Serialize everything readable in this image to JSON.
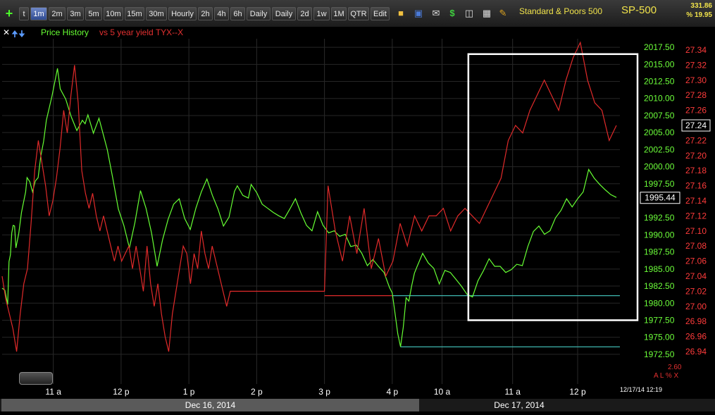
{
  "toolbar": {
    "buttons": [
      "t",
      "1m",
      "2m",
      "3m",
      "5m",
      "10m",
      "15m",
      "30m",
      "Hourly",
      "2h",
      "4h",
      "6h",
      "Daily",
      "Daily",
      "2d",
      "1w",
      "1M",
      "QTR",
      "Edit"
    ],
    "active": "1m",
    "symbol_name": "Standard & Poors 500",
    "ticker": "SP-500",
    "change_value": "331.86",
    "change_pct": "% 19.95"
  },
  "legend": {
    "label1": "Price History",
    "label2": "vs 5 year yield TYX--X"
  },
  "footer": {
    "dates": [
      "Dec 16, 2014",
      "Dec 17, 2014"
    ],
    "timestamp": "12/17/14 12:19",
    "small_label": "2.60",
    "indicator_letters": "A L % X"
  },
  "colors": {
    "price": "#66ff33",
    "yield": "#e02a2a",
    "left_axis": "#6cff3a",
    "right_axis": "#ff3b3b",
    "cyan": "#3fb8b0",
    "box": "#ffffff"
  },
  "chart_data": {
    "type": "line",
    "x_ticks": [
      "11 a",
      "12 p",
      "1 p",
      "2 p",
      "3 p",
      "4 p",
      "10 a",
      "11 a",
      "12 p"
    ],
    "left_axis": {
      "ticks": [
        2017.5,
        2015,
        2012.5,
        2010,
        2007.5,
        2005,
        2002.5,
        2000,
        1997.5,
        1995,
        1992.5,
        1990,
        1987.5,
        1985,
        1982.5,
        1980,
        1977.5,
        1975,
        1972.5
      ],
      "range": [
        1971.25,
        2018.75
      ],
      "current": 1995.44
    },
    "right_axis": {
      "ticks": [
        27.34,
        27.32,
        27.3,
        27.28,
        27.26,
        27.24,
        27.22,
        27.2,
        27.18,
        27.16,
        27.14,
        27.12,
        27.1,
        27.08,
        27.06,
        27.04,
        27.02,
        27.0,
        26.98,
        26.96,
        26.94
      ],
      "range": [
        26.925,
        27.355
      ],
      "current": 27.24
    },
    "horizontal_lines": [
      {
        "axis": "left",
        "value": 1981.1,
        "from": "3 p",
        "to": "end",
        "color": "red-cyan"
      },
      {
        "axis": "left",
        "value": 1973.6,
        "from": "4 p",
        "to": "end",
        "color": "cyan"
      }
    ],
    "series": [
      {
        "name": "Price History",
        "axis": "left",
        "points": [
          [
            0,
            1982.2
          ],
          [
            0.1,
            1981.9
          ],
          [
            0.2,
            1979.8
          ],
          [
            0.25,
            1986.1
          ],
          [
            0.3,
            1987.1
          ],
          [
            0.35,
            1990.3
          ],
          [
            0.4,
            1991.4
          ],
          [
            0.45,
            1991.3
          ],
          [
            0.5,
            1988.1
          ],
          [
            0.6,
            1990.2
          ],
          [
            0.7,
            1993.3
          ],
          [
            0.8,
            1995.3
          ],
          [
            0.85,
            1996.3
          ],
          [
            0.9,
            1998.4
          ],
          [
            1,
            1997.8
          ],
          [
            1.1,
            1996.3
          ],
          [
            1.2,
            1997.9
          ],
          [
            1.3,
            1998.4
          ],
          [
            1.4,
            2001.6
          ],
          [
            1.5,
            2003.7
          ],
          [
            1.6,
            2006.8
          ],
          [
            1.8,
            2010.3
          ],
          [
            2,
            2014.4
          ],
          [
            2.1,
            2011.4
          ],
          [
            2.3,
            2009.9
          ],
          [
            2.5,
            2007.3
          ],
          [
            2.7,
            2005.3
          ],
          [
            2.9,
            2006.8
          ],
          [
            3,
            2006.3
          ],
          [
            3.1,
            2007.6
          ],
          [
            3.3,
            2004.9
          ],
          [
            3.5,
            2007.1
          ],
          [
            3.8,
            2002.5
          ],
          [
            4,
            1998.3
          ],
          [
            4.2,
            1993.8
          ],
          [
            4.4,
            1991.4
          ],
          [
            4.6,
            1988.1
          ],
          [
            4.8,
            1991.8
          ],
          [
            5,
            1996.5
          ],
          [
            5.2,
            1993.9
          ],
          [
            5.4,
            1990.3
          ],
          [
            5.6,
            1985.4
          ],
          [
            5.8,
            1989.3
          ],
          [
            6,
            1992.3
          ],
          [
            6.2,
            1994.5
          ],
          [
            6.4,
            1995.3
          ],
          [
            6.6,
            1992.4
          ],
          [
            6.8,
            1990.8
          ],
          [
            7,
            1993.9
          ],
          [
            7.2,
            1996.3
          ],
          [
            7.4,
            1998.2
          ],
          [
            7.6,
            1995.8
          ],
          [
            7.8,
            1993.8
          ],
          [
            8,
            1991.3
          ],
          [
            8.2,
            1992.6
          ],
          [
            8.4,
            1996.4
          ],
          [
            8.5,
            1997.2
          ],
          [
            8.7,
            1995.8
          ],
          [
            8.9,
            1995.4
          ],
          [
            9,
            1997.4
          ],
          [
            9.2,
            1996.2
          ],
          [
            9.4,
            1994.5
          ],
          [
            9.6,
            1993.9
          ],
          [
            9.8,
            1993.3
          ],
          [
            10,
            1992.8
          ],
          [
            10.2,
            1992.4
          ],
          [
            10.4,
            1993.8
          ],
          [
            10.6,
            1995.3
          ],
          [
            10.8,
            1993.2
          ],
          [
            11,
            1991.4
          ],
          [
            11.2,
            1990.6
          ],
          [
            11.4,
            1993.4
          ],
          [
            11.6,
            1991.4
          ],
          [
            11.8,
            1990.3
          ],
          [
            12,
            1990.6
          ],
          [
            12.2,
            1989.8
          ],
          [
            12.4,
            1990.1
          ],
          [
            12.6,
            1988.3
          ],
          [
            12.8,
            1988.5
          ],
          [
            13,
            1987.3
          ],
          [
            13.2,
            1985.5
          ],
          [
            13.4,
            1986.4
          ],
          [
            13.6,
            1985.4
          ],
          [
            13.8,
            1984.5
          ],
          [
            14,
            1982.3
          ],
          [
            14.1,
            1981.5
          ],
          [
            14.2,
            1978.5
          ],
          [
            14.3,
            1975.5
          ],
          [
            14.4,
            1973.6
          ],
          [
            14.5,
            1976.5
          ],
          [
            14.6,
            1980.8
          ],
          [
            14.7,
            1980.3
          ],
          [
            14.8,
            1982.5
          ],
          [
            14.9,
            1984.4
          ],
          [
            15,
            1985.4
          ],
          [
            15.2,
            1987.3
          ],
          [
            15.4,
            1985.9
          ],
          [
            15.6,
            1985.1
          ],
          [
            15.8,
            1982.8
          ],
          [
            16,
            1984.8
          ],
          [
            16.2,
            1984.5
          ],
          [
            16.4,
            1983.5
          ],
          [
            16.6,
            1982.5
          ],
          [
            16.8,
            1981.3
          ],
          [
            17,
            1980.9
          ],
          [
            17.2,
            1983.3
          ],
          [
            17.4,
            1984.8
          ],
          [
            17.6,
            1986.5
          ],
          [
            17.8,
            1985.4
          ],
          [
            18,
            1985.4
          ],
          [
            18.2,
            1984.5
          ],
          [
            18.4,
            1984.9
          ],
          [
            18.6,
            1985.7
          ],
          [
            18.8,
            1985.5
          ],
          [
            19,
            1988.3
          ],
          [
            19.2,
            1990.5
          ],
          [
            19.4,
            1991.3
          ],
          [
            19.6,
            1990.1
          ],
          [
            19.8,
            1990.6
          ],
          [
            20,
            1992.5
          ],
          [
            20.2,
            1993.6
          ],
          [
            20.4,
            1995.3
          ],
          [
            20.6,
            1994.1
          ],
          [
            20.8,
            1995.3
          ],
          [
            21,
            1996.3
          ],
          [
            21.2,
            1999.6
          ],
          [
            21.4,
            1998.3
          ],
          [
            21.6,
            1997.4
          ],
          [
            21.8,
            1996.6
          ],
          [
            22,
            1995.9
          ],
          [
            22.2,
            1995.5
          ]
        ]
      },
      {
        "name": "vs 5 year yield TYX--X",
        "axis": "right",
        "points": [
          [
            0,
            27.04
          ],
          [
            0.1,
            27.01
          ],
          [
            0.2,
            26.99
          ],
          [
            0.3,
            26.97
          ],
          [
            0.4,
            26.94
          ],
          [
            0.5,
            26.99
          ],
          [
            0.6,
            27.03
          ],
          [
            0.7,
            27.05
          ],
          [
            0.8,
            27.11
          ],
          [
            0.9,
            27.18
          ],
          [
            1,
            27.22
          ],
          [
            1.1,
            27.19
          ],
          [
            1.2,
            27.16
          ],
          [
            1.3,
            27.12
          ],
          [
            1.4,
            27.14
          ],
          [
            1.5,
            27.17
          ],
          [
            1.6,
            27.21
          ],
          [
            1.7,
            27.26
          ],
          [
            1.8,
            27.23
          ],
          [
            1.9,
            27.28
          ],
          [
            2,
            27.32
          ],
          [
            2.1,
            27.27
          ],
          [
            2.2,
            27.18
          ],
          [
            2.3,
            27.15
          ],
          [
            2.4,
            27.13
          ],
          [
            2.5,
            27.15
          ],
          [
            2.6,
            27.12
          ],
          [
            2.7,
            27.1
          ],
          [
            2.8,
            27.12
          ],
          [
            2.9,
            27.1
          ],
          [
            3,
            27.08
          ],
          [
            3.1,
            27.06
          ],
          [
            3.2,
            27.08
          ],
          [
            3.3,
            27.06
          ],
          [
            3.4,
            27.07
          ],
          [
            3.5,
            27.08
          ],
          [
            3.6,
            27.05
          ],
          [
            3.7,
            27.08
          ],
          [
            3.8,
            27.05
          ],
          [
            3.9,
            27.02
          ],
          [
            4,
            27.08
          ],
          [
            4.1,
            27.03
          ],
          [
            4.2,
            27.0
          ],
          [
            4.3,
            27.03
          ],
          [
            4.4,
            26.99
          ],
          [
            4.5,
            26.96
          ],
          [
            4.6,
            26.94
          ],
          [
            4.7,
            26.99
          ],
          [
            4.8,
            27.02
          ],
          [
            4.9,
            27.05
          ],
          [
            5,
            27.08
          ],
          [
            5.1,
            27.07
          ],
          [
            5.2,
            27.03
          ],
          [
            5.3,
            27.07
          ],
          [
            5.4,
            27.05
          ],
          [
            5.5,
            27.1
          ],
          [
            5.6,
            27.07
          ],
          [
            5.7,
            27.05
          ],
          [
            5.8,
            27.08
          ],
          [
            5.9,
            27.06
          ],
          [
            6,
            27.04
          ],
          [
            6.1,
            27.02
          ],
          [
            6.2,
            27.0
          ],
          [
            6.3,
            27.02
          ],
          [
            6.4,
            27.02
          ],
          [
            6.5,
            27.02
          ],
          [
            6.6,
            27.02
          ],
          [
            6.7,
            27.02
          ],
          [
            6.8,
            27.02
          ],
          [
            6.9,
            27.02
          ],
          [
            7,
            27.02
          ],
          [
            7.1,
            27.02
          ],
          [
            7.2,
            27.02
          ],
          [
            7.3,
            27.02
          ],
          [
            7.4,
            27.02
          ],
          [
            7.5,
            27.02
          ],
          [
            7.6,
            27.02
          ],
          [
            7.7,
            27.02
          ],
          [
            7.8,
            27.02
          ],
          [
            7.9,
            27.02
          ],
          [
            8,
            27.02
          ],
          [
            8.1,
            27.02
          ],
          [
            8.2,
            27.02
          ],
          [
            8.3,
            27.02
          ],
          [
            8.4,
            27.02
          ],
          [
            8.5,
            27.02
          ],
          [
            8.6,
            27.02
          ],
          [
            8.7,
            27.02
          ],
          [
            8.8,
            27.02
          ],
          [
            8.9,
            27.02
          ],
          [
            9,
            27.16
          ],
          [
            9.2,
            27.1
          ],
          [
            9.4,
            27.06
          ],
          [
            9.6,
            27.12
          ],
          [
            9.8,
            27.07
          ],
          [
            10,
            27.13
          ],
          [
            10.2,
            27.05
          ],
          [
            10.4,
            27.09
          ],
          [
            10.6,
            27.04
          ],
          [
            10.8,
            27.06
          ],
          [
            11,
            27.11
          ],
          [
            11.2,
            27.08
          ],
          [
            11.4,
            27.12
          ],
          [
            11.6,
            27.1
          ],
          [
            11.8,
            27.12
          ],
          [
            12,
            27.12
          ],
          [
            12.2,
            27.13
          ],
          [
            12.4,
            27.1
          ],
          [
            12.6,
            27.12
          ],
          [
            12.8,
            27.13
          ],
          [
            13,
            27.12
          ],
          [
            13.2,
            27.11
          ],
          [
            13.4,
            27.13
          ],
          [
            13.6,
            27.15
          ],
          [
            13.8,
            27.17
          ],
          [
            14,
            27.22
          ],
          [
            14.2,
            27.24
          ],
          [
            14.4,
            27.23
          ],
          [
            14.6,
            27.26
          ],
          [
            14.8,
            27.28
          ],
          [
            15,
            27.3
          ],
          [
            15.2,
            27.28
          ],
          [
            15.4,
            27.26
          ],
          [
            15.6,
            27.3
          ],
          [
            15.8,
            27.33
          ],
          [
            16,
            27.35
          ],
          [
            16.2,
            27.3
          ],
          [
            16.4,
            27.27
          ],
          [
            16.6,
            27.26
          ],
          [
            16.8,
            27.22
          ],
          [
            17,
            27.24
          ]
        ]
      }
    ],
    "box": {
      "from_x": "10:30a Dec17",
      "to_x": "end",
      "top": 2016.5,
      "bottom": 1977.5
    }
  }
}
